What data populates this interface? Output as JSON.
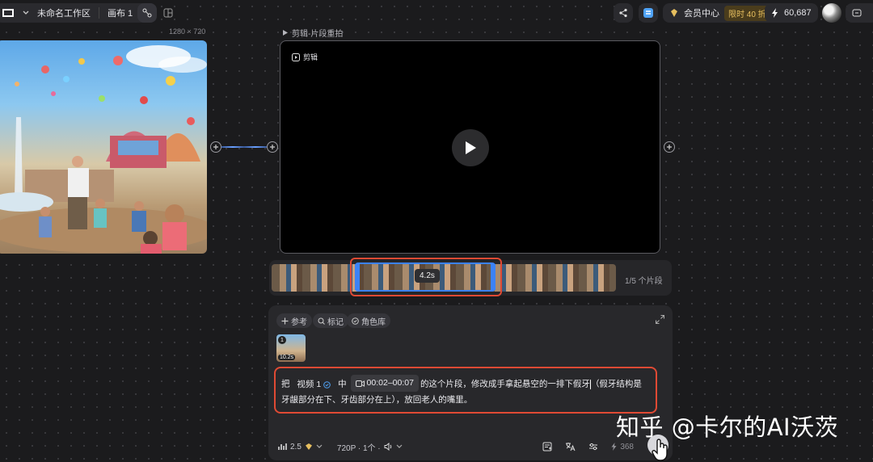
{
  "topbar": {
    "workspace": "未命名工作区",
    "canvas": "画布 1",
    "member_label": "会员中心",
    "member_promo": "限时 40 折",
    "credits": "60,687"
  },
  "left_node": {
    "resolution": "1280 × 720"
  },
  "video_card": {
    "title": "剪辑-片段重拍",
    "tag": "剪辑"
  },
  "timeline": {
    "duration": "4.2s",
    "segment_counter": "1/5 个片段"
  },
  "panel": {
    "chips": [
      "参考",
      "标记",
      "角色库"
    ],
    "thumb_index": "1",
    "thumb_time": "10.2s",
    "prompt": {
      "prefix": "把",
      "video_ref": "视频 1",
      "mid": "中",
      "time_range": "00:02–00:07",
      "text1": "的这个片段，修改成手拿起悬空的一排下假牙",
      "text2": "（假牙结构是牙龈部分在下、牙齿部分在上），放回老人的嘴里。"
    },
    "model_version": "2.5",
    "quality": "720P · 1个 ·",
    "cost": "368"
  },
  "watermark": "知乎 @卡尔的AI沃茨",
  "colors": {
    "highlight_red": "#e04a34",
    "selection_blue": "#3b82f6",
    "gold": "#e7bf5f"
  }
}
